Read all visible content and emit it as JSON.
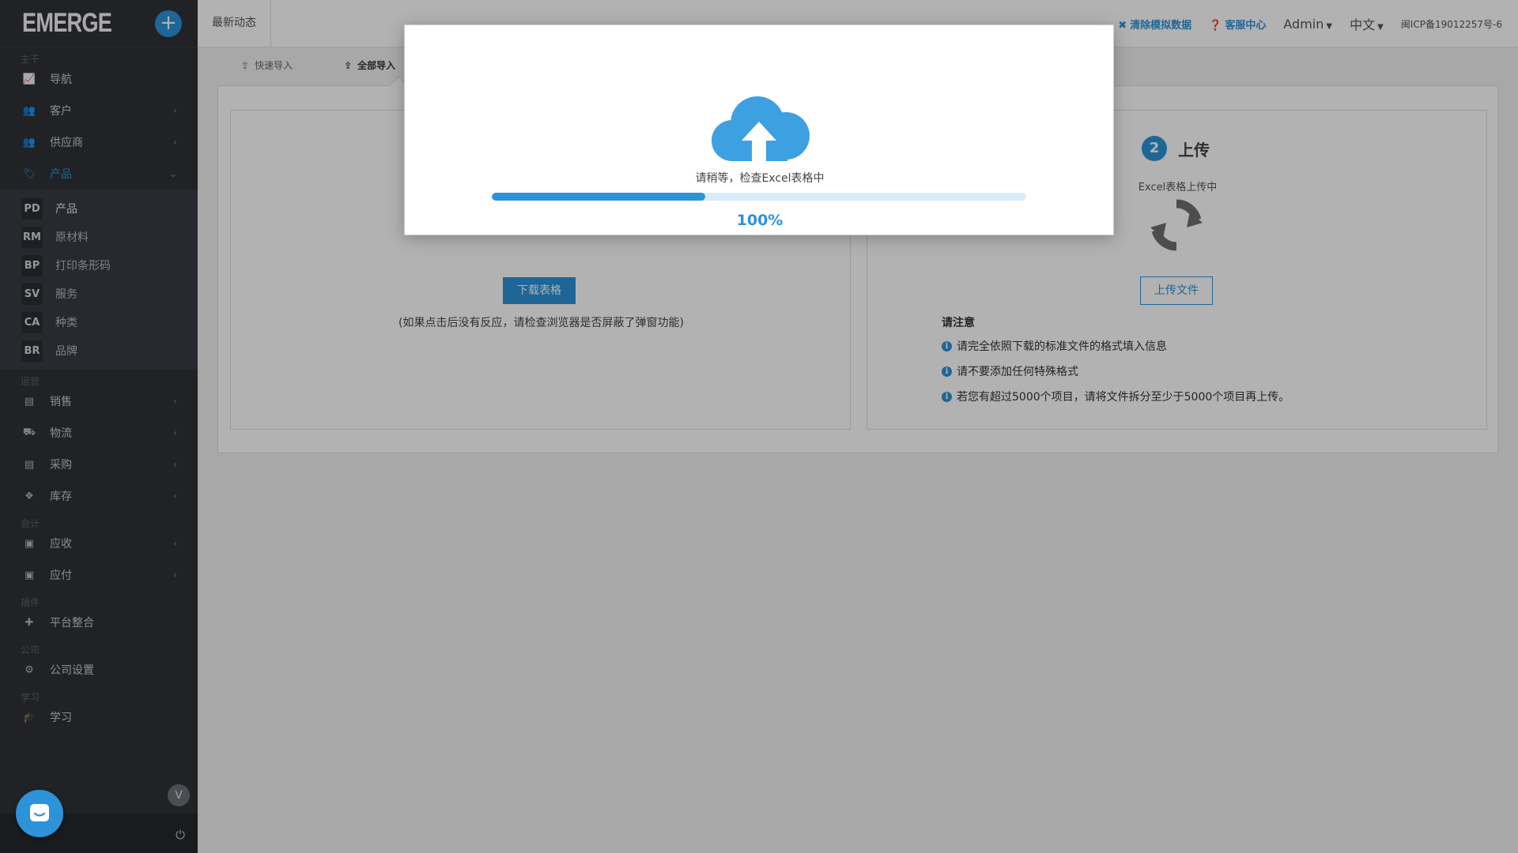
{
  "sidebar": {
    "logo": "EMERGE",
    "plus": "+",
    "sections": {
      "main": "主干",
      "operations": "运营",
      "accounting": "会计",
      "plugins": "插件",
      "company": "公司",
      "learning": "学习"
    },
    "items": {
      "nav": "导航",
      "customers": "客户",
      "suppliers": "供应商",
      "products": "产品",
      "sales": "销售",
      "logistics": "物流",
      "purchasing": "采购",
      "inventory": "库存",
      "receivable": "应收",
      "payable": "应付",
      "platform": "平台整合",
      "company_settings": "公司设置",
      "learn": "学习"
    },
    "sub_items": [
      {
        "code": "PD",
        "label": "产品"
      },
      {
        "code": "RM",
        "label": "原材料"
      },
      {
        "code": "BP",
        "label": "打印条形码"
      },
      {
        "code": "SV",
        "label": "服务"
      },
      {
        "code": "CA",
        "label": "种类"
      },
      {
        "code": "BR",
        "label": "品牌"
      }
    ],
    "collapse_label": "V"
  },
  "topbar": {
    "tab": "最新动态",
    "clear_demo": "清除模拟数据",
    "support": "客服中心",
    "user": "Admin",
    "language": "中文",
    "icp": "闽ICP备19012257号-6"
  },
  "content": {
    "tabs": [
      "快速导入",
      "全部导入"
    ],
    "download_button": "下载表格",
    "download_note": "(如果点击后没有反应，请检查浏览器是否屏蔽了弹窗功能)",
    "step_number": "2",
    "step_title": "上传",
    "upload_status": "Excel表格上传中",
    "upload_button": "上传文件",
    "notice_title": "请注意",
    "notices": [
      "请完全依照下载的标准文件的格式填入信息",
      "请不要添加任何特殊格式",
      "若您有超过5000个项目，请将文件拆分至少于5000个项目再上传。"
    ]
  },
  "modal": {
    "message": "请稍等，检查Excel表格中",
    "progress_fraction": 0.4,
    "progress_label": "100%"
  },
  "colors": {
    "accent": "#2c93d9",
    "sidebar_bg": "#2f3237"
  }
}
